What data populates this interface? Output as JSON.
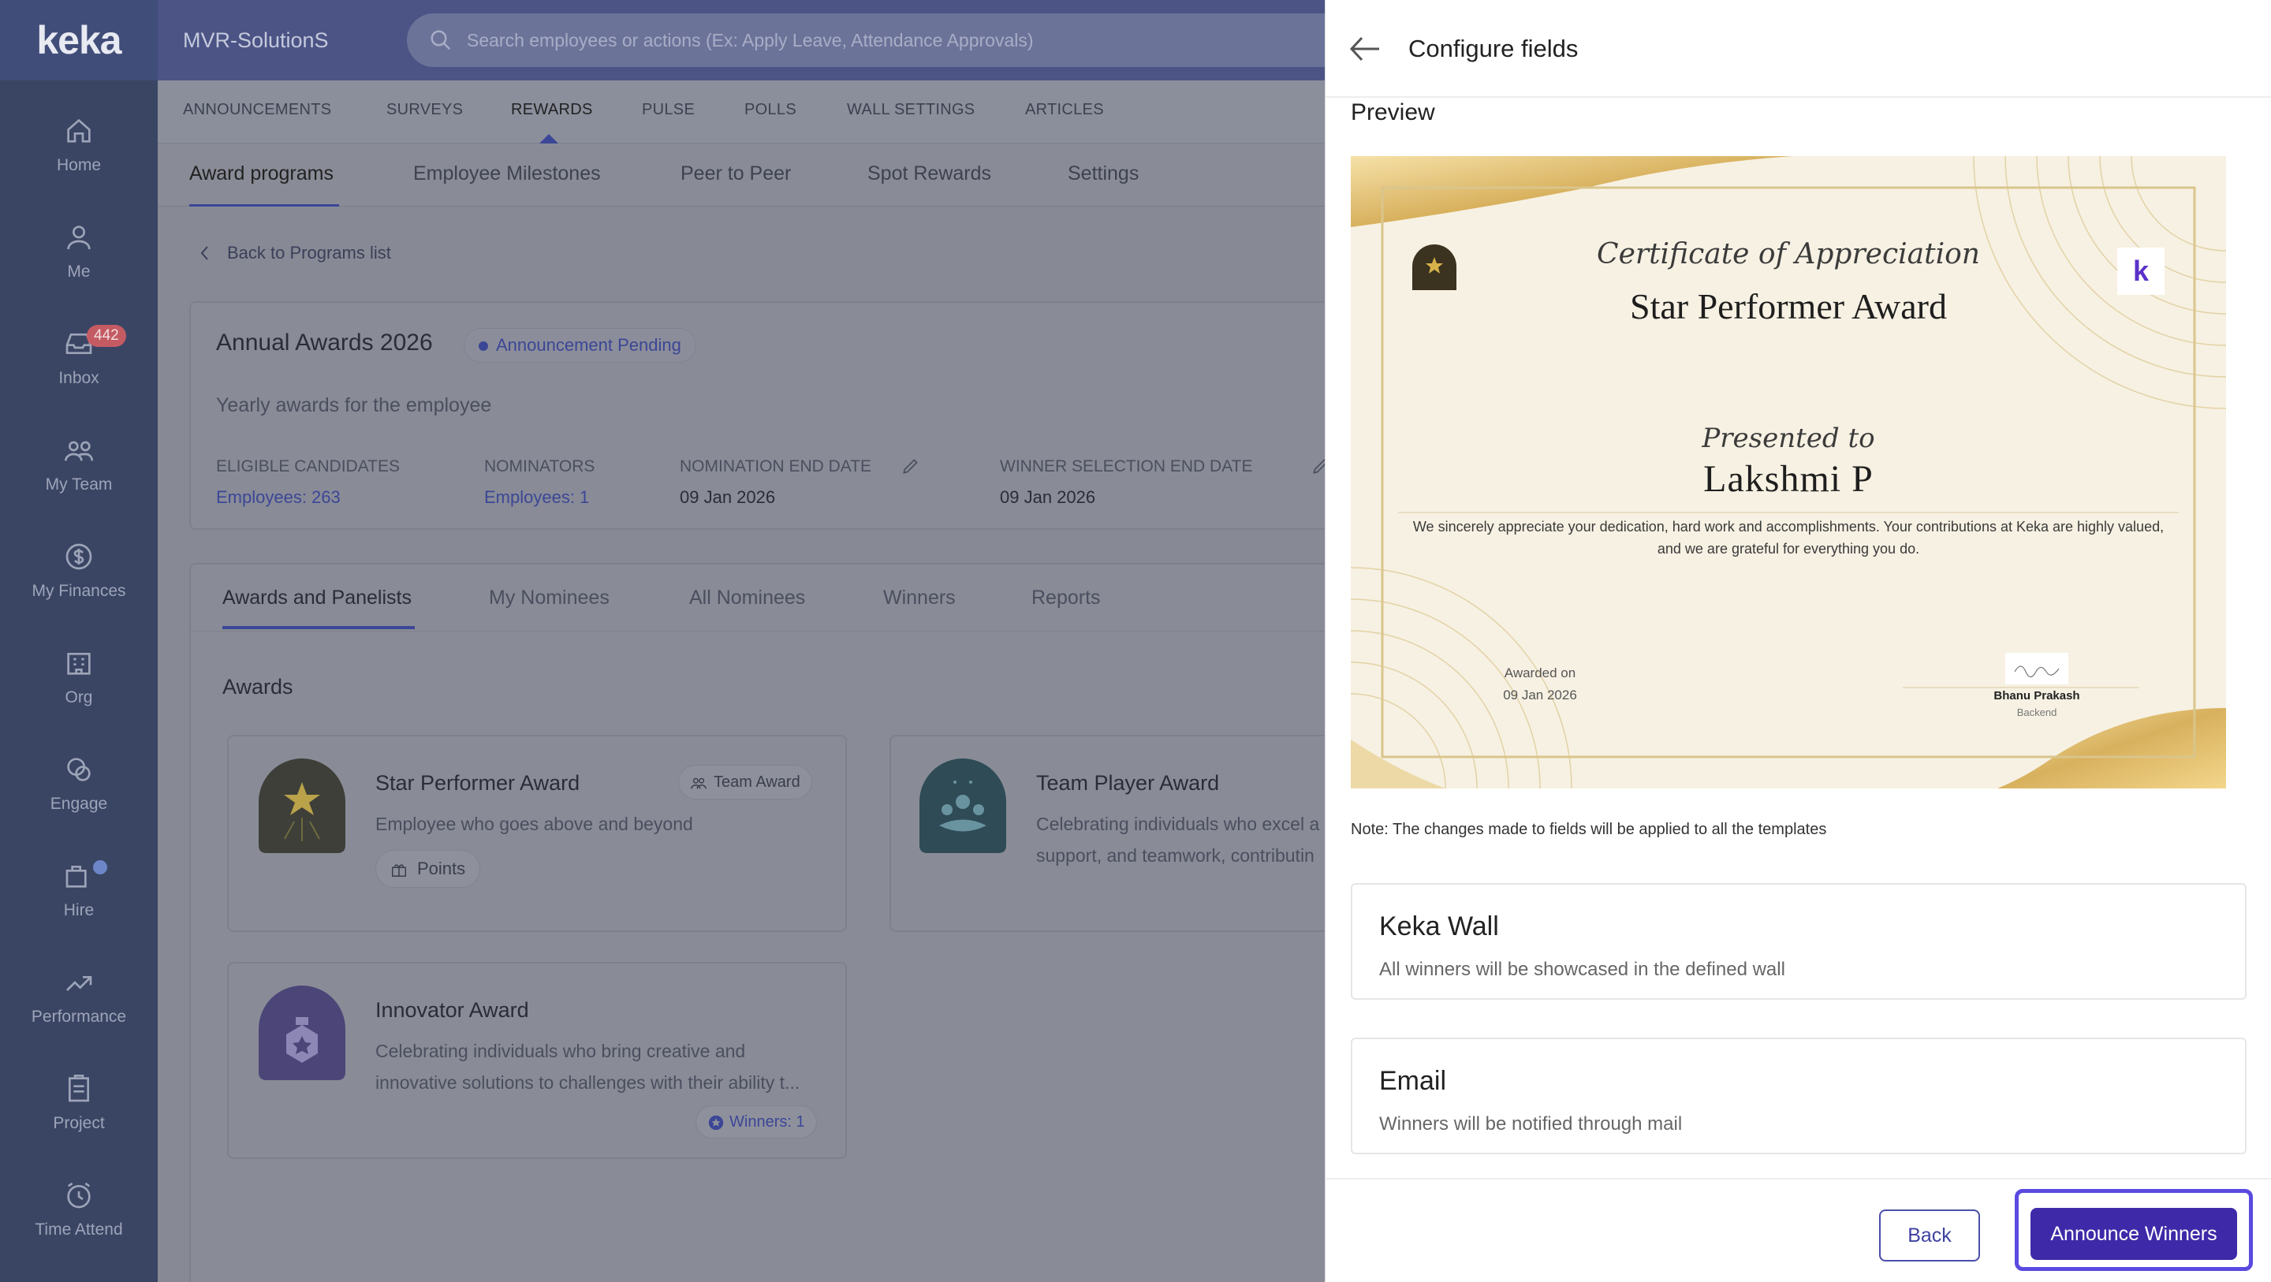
{
  "sidebar": {
    "logo": "keka",
    "items": [
      {
        "label": "Home",
        "icon": "home-icon"
      },
      {
        "label": "Me",
        "icon": "user-icon"
      },
      {
        "label": "Inbox",
        "icon": "inbox-icon",
        "badge": "442"
      },
      {
        "label": "My Team",
        "icon": "team-icon"
      },
      {
        "label": "My Finances",
        "icon": "finance-icon"
      },
      {
        "label": "Org",
        "icon": "org-icon"
      },
      {
        "label": "Engage",
        "icon": "engage-icon"
      },
      {
        "label": "Hire",
        "icon": "hire-icon"
      },
      {
        "label": "Performance",
        "icon": "performance-icon"
      },
      {
        "label": "Project",
        "icon": "project-icon"
      },
      {
        "label": "Time Attend",
        "icon": "time-icon"
      }
    ]
  },
  "header": {
    "org_name": "MVR-SolutionS",
    "search_placeholder": "Search employees or actions (Ex: Apply Leave, Attendance Approvals)"
  },
  "primary_tabs": [
    "ANNOUNCEMENTS",
    "SURVEYS",
    "REWARDS",
    "PULSE",
    "POLLS",
    "WALL SETTINGS",
    "ARTICLES"
  ],
  "secondary_tabs": [
    "Award programs",
    "Employee Milestones",
    "Peer to Peer",
    "Spot Rewards",
    "Settings"
  ],
  "program": {
    "back_link": "Back to Programs list",
    "title": "Annual Awards 2026",
    "status": "Announcement Pending",
    "description": "Yearly awards for the employee",
    "stats": [
      {
        "label": "ELIGIBLE CANDIDATES",
        "value": "Employees: 263"
      },
      {
        "label": "NOMINATORS",
        "value": "Employees: 1"
      },
      {
        "label": "NOMINATION END DATE",
        "value": "09 Jan 2026"
      },
      {
        "label": "WINNER SELECTION END DATE",
        "value": "09 Jan 2026"
      }
    ],
    "tabs": [
      "Awards and Panelists",
      "My Nominees",
      "All Nominees",
      "Winners",
      "Reports"
    ],
    "awards_heading": "Awards",
    "awards": [
      {
        "title": "Star Performer Award",
        "tag": "Team Award",
        "desc1": "Employee who goes above and beyond",
        "chip": "Points"
      },
      {
        "title": "Team Player Award",
        "desc1": "Celebrating individuals who excel a",
        "desc2": "support, and teamwork, contributin"
      },
      {
        "title": "Innovator Award",
        "desc1": "Celebrating individuals who bring creative and",
        "desc2": "innovative solutions to challenges with their ability t...",
        "chip": "Winners: 1"
      }
    ]
  },
  "panel": {
    "title": "Configure fields",
    "preview_label": "Preview",
    "certificate": {
      "script_title": "Certificate of Appreciation",
      "award_name": "Star Performer Award",
      "presented_to": "Presented to",
      "recipient": "Lakshmi P",
      "message": "We sincerely appreciate your dedication, hard work and accomplishments. Your contributions at Keka are highly valued, and we are grateful for everything you do.",
      "awarded_on_label": "Awarded on",
      "awarded_on_date": "09 Jan 2026",
      "signer_name": "Bhanu Prakash",
      "signer_dept": "Backend"
    },
    "note": "Note: The changes made to fields will be applied to all the templates",
    "options": [
      {
        "title": "Keka Wall",
        "desc": "All winners will be showcased in the defined wall"
      },
      {
        "title": "Email",
        "desc": "Winners will be notified through mail"
      }
    ],
    "back_button": "Back",
    "announce_button": "Announce Winners"
  }
}
